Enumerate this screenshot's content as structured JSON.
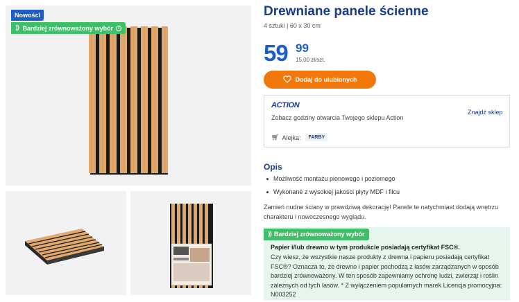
{
  "badges": {
    "new": "Nowości",
    "eco": "Bardziej zrównoważony wybór"
  },
  "product": {
    "title": "Drewniane panele ścienne",
    "subtitle": "4 sztuki | 60 x 30 cm",
    "price_main": "59",
    "price_cents": "99",
    "unit_price": "15,00 zł/szt."
  },
  "actions": {
    "favorite_label": "Dodaj do ulubionych"
  },
  "store": {
    "logo_text": "ACTION",
    "hours_text": "Zobacz godziny otwarcia Twojego sklepu Action",
    "find_store": "Znajdź sklep",
    "aisle_label": "Alejka:",
    "aisle_value": "FARBY"
  },
  "description": {
    "title": "Opis",
    "bullets": [
      "Możliwość montażu pionowego i poziomego",
      "Wykonane z wysokiej jakości płyty MDF i filcu"
    ],
    "paragraph": "Zamień nudne ściany w prawdziwą dekorację! Panele te natychmiast dodają wnętrzu charakteru i nowoczesnego wyglądu."
  },
  "eco_section": {
    "badge": "Bardziej zrównoważony wybór",
    "heading": "Papier i/lub drewno w tym produkcie posiadają certyfikat FSC®.",
    "text": "Czy wiesz, że wszystkie nasze produkty z drewna i papieru posiadają certyfikat FSC®? Oznacza to, że drewno i papier pochodzą z lasów zarządzanych w sposób bardziej zrównoważony. W ten sposób zapewniamy ochronę ludzi, zwierząt i roślin zależnych od tych lasów. * Z wyłączeniem popularnych marek Licencja promocyjna: N003252"
  },
  "colors": {
    "brand_blue": "#1b5ec6",
    "accent_orange": "#f2780c",
    "eco_green": "#3fbf6a",
    "wood": "#e0a86c"
  }
}
